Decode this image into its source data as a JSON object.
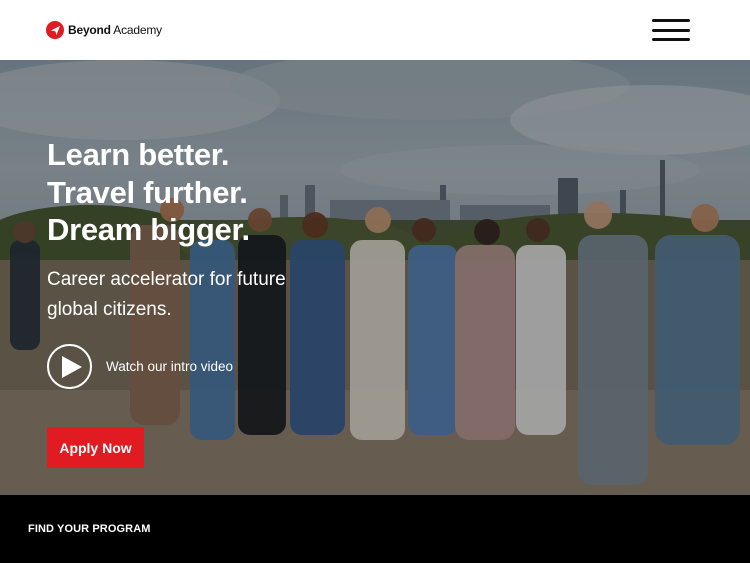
{
  "brand": {
    "name_bold": "Beyond",
    "name_regular": "Academy",
    "accent_color": "#e11b22"
  },
  "header": {
    "menu_icon": "hamburger-menu-icon"
  },
  "hero": {
    "headline_lines": [
      "Learn better.",
      "Travel further.",
      "Dream bigger."
    ],
    "subtitle": "Career accelerator for future global citizens.",
    "video_label": "Watch our intro video",
    "play_icon": "play-icon",
    "cta_label": "Apply Now"
  },
  "footer": {
    "find_program_label": "FIND YOUR PROGRAM"
  }
}
